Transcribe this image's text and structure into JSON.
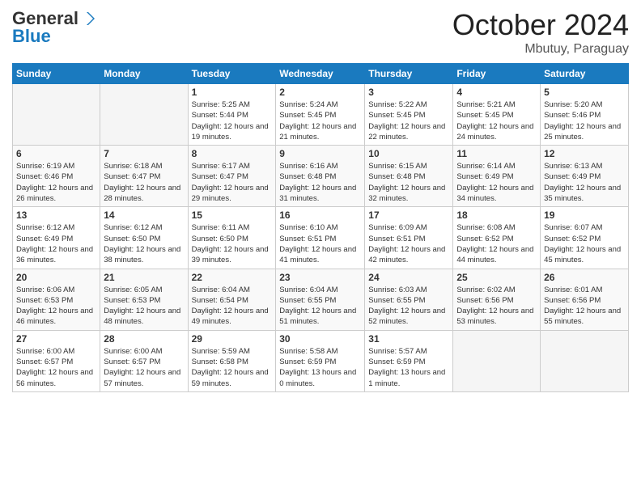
{
  "header": {
    "logo_general": "General",
    "logo_blue": "Blue",
    "month": "October 2024",
    "location": "Mbutuy, Paraguay"
  },
  "weekdays": [
    "Sunday",
    "Monday",
    "Tuesday",
    "Wednesday",
    "Thursday",
    "Friday",
    "Saturday"
  ],
  "weeks": [
    [
      {
        "day": "",
        "info": ""
      },
      {
        "day": "",
        "info": ""
      },
      {
        "day": "1",
        "info": "Sunrise: 5:25 AM\nSunset: 5:44 PM\nDaylight: 12 hours and 19 minutes."
      },
      {
        "day": "2",
        "info": "Sunrise: 5:24 AM\nSunset: 5:45 PM\nDaylight: 12 hours and 21 minutes."
      },
      {
        "day": "3",
        "info": "Sunrise: 5:22 AM\nSunset: 5:45 PM\nDaylight: 12 hours and 22 minutes."
      },
      {
        "day": "4",
        "info": "Sunrise: 5:21 AM\nSunset: 5:45 PM\nDaylight: 12 hours and 24 minutes."
      },
      {
        "day": "5",
        "info": "Sunrise: 5:20 AM\nSunset: 5:46 PM\nDaylight: 12 hours and 25 minutes."
      }
    ],
    [
      {
        "day": "6",
        "info": "Sunrise: 6:19 AM\nSunset: 6:46 PM\nDaylight: 12 hours and 26 minutes."
      },
      {
        "day": "7",
        "info": "Sunrise: 6:18 AM\nSunset: 6:47 PM\nDaylight: 12 hours and 28 minutes."
      },
      {
        "day": "8",
        "info": "Sunrise: 6:17 AM\nSunset: 6:47 PM\nDaylight: 12 hours and 29 minutes."
      },
      {
        "day": "9",
        "info": "Sunrise: 6:16 AM\nSunset: 6:48 PM\nDaylight: 12 hours and 31 minutes."
      },
      {
        "day": "10",
        "info": "Sunrise: 6:15 AM\nSunset: 6:48 PM\nDaylight: 12 hours and 32 minutes."
      },
      {
        "day": "11",
        "info": "Sunrise: 6:14 AM\nSunset: 6:49 PM\nDaylight: 12 hours and 34 minutes."
      },
      {
        "day": "12",
        "info": "Sunrise: 6:13 AM\nSunset: 6:49 PM\nDaylight: 12 hours and 35 minutes."
      }
    ],
    [
      {
        "day": "13",
        "info": "Sunrise: 6:12 AM\nSunset: 6:49 PM\nDaylight: 12 hours and 36 minutes."
      },
      {
        "day": "14",
        "info": "Sunrise: 6:12 AM\nSunset: 6:50 PM\nDaylight: 12 hours and 38 minutes."
      },
      {
        "day": "15",
        "info": "Sunrise: 6:11 AM\nSunset: 6:50 PM\nDaylight: 12 hours and 39 minutes."
      },
      {
        "day": "16",
        "info": "Sunrise: 6:10 AM\nSunset: 6:51 PM\nDaylight: 12 hours and 41 minutes."
      },
      {
        "day": "17",
        "info": "Sunrise: 6:09 AM\nSunset: 6:51 PM\nDaylight: 12 hours and 42 minutes."
      },
      {
        "day": "18",
        "info": "Sunrise: 6:08 AM\nSunset: 6:52 PM\nDaylight: 12 hours and 44 minutes."
      },
      {
        "day": "19",
        "info": "Sunrise: 6:07 AM\nSunset: 6:52 PM\nDaylight: 12 hours and 45 minutes."
      }
    ],
    [
      {
        "day": "20",
        "info": "Sunrise: 6:06 AM\nSunset: 6:53 PM\nDaylight: 12 hours and 46 minutes."
      },
      {
        "day": "21",
        "info": "Sunrise: 6:05 AM\nSunset: 6:53 PM\nDaylight: 12 hours and 48 minutes."
      },
      {
        "day": "22",
        "info": "Sunrise: 6:04 AM\nSunset: 6:54 PM\nDaylight: 12 hours and 49 minutes."
      },
      {
        "day": "23",
        "info": "Sunrise: 6:04 AM\nSunset: 6:55 PM\nDaylight: 12 hours and 51 minutes."
      },
      {
        "day": "24",
        "info": "Sunrise: 6:03 AM\nSunset: 6:55 PM\nDaylight: 12 hours and 52 minutes."
      },
      {
        "day": "25",
        "info": "Sunrise: 6:02 AM\nSunset: 6:56 PM\nDaylight: 12 hours and 53 minutes."
      },
      {
        "day": "26",
        "info": "Sunrise: 6:01 AM\nSunset: 6:56 PM\nDaylight: 12 hours and 55 minutes."
      }
    ],
    [
      {
        "day": "27",
        "info": "Sunrise: 6:00 AM\nSunset: 6:57 PM\nDaylight: 12 hours and 56 minutes."
      },
      {
        "day": "28",
        "info": "Sunrise: 6:00 AM\nSunset: 6:57 PM\nDaylight: 12 hours and 57 minutes."
      },
      {
        "day": "29",
        "info": "Sunrise: 5:59 AM\nSunset: 6:58 PM\nDaylight: 12 hours and 59 minutes."
      },
      {
        "day": "30",
        "info": "Sunrise: 5:58 AM\nSunset: 6:59 PM\nDaylight: 13 hours and 0 minutes."
      },
      {
        "day": "31",
        "info": "Sunrise: 5:57 AM\nSunset: 6:59 PM\nDaylight: 13 hours and 1 minute."
      },
      {
        "day": "",
        "info": ""
      },
      {
        "day": "",
        "info": ""
      }
    ]
  ]
}
